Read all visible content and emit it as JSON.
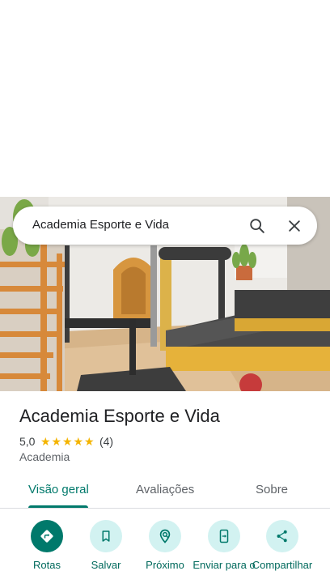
{
  "search": {
    "query": "Academia Esporte e Vida",
    "search_icon": "search-icon",
    "close_icon": "close-icon"
  },
  "place": {
    "name": "Academia Esporte e Vida",
    "rating": "5,0",
    "stars": 5,
    "review_count": "(4)",
    "category": "Academia",
    "photo": "pilates-studio-photo"
  },
  "tabs": [
    {
      "label": "Visão geral",
      "active": true
    },
    {
      "label": "Avaliações",
      "active": false
    },
    {
      "label": "Sobre",
      "active": false
    }
  ],
  "actions": [
    {
      "label": "Rotas",
      "icon": "directions-icon"
    },
    {
      "label": "Salvar",
      "icon": "bookmark-icon"
    },
    {
      "label": "Próximo",
      "icon": "nearby-icon"
    },
    {
      "label": "Enviar para o",
      "icon": "send-to-phone-icon"
    },
    {
      "label": "Compartilhar",
      "icon": "share-icon"
    }
  ],
  "colors": {
    "accent": "#00796b",
    "action_bg": "#d2f2f1",
    "star": "#f4b400"
  }
}
